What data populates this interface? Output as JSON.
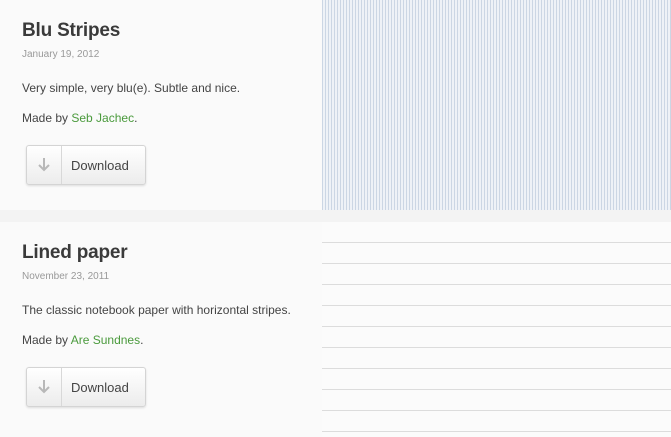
{
  "patterns": [
    {
      "title": "Blu Stripes",
      "date": "January 19, 2012",
      "description": "Very simple, very blu(e). Subtle and nice.",
      "made_by_prefix": "Made by ",
      "author": "Seb Jachec",
      "made_by_suffix": ".",
      "download_label": "Download",
      "preview": "blue vertical stripes"
    },
    {
      "title": "Lined paper",
      "date": "November 23, 2011",
      "description": "The classic notebook paper with horizontal stripes.",
      "made_by_prefix": "Made by ",
      "author": "Are Sundnes",
      "made_by_suffix": ".",
      "download_label": "Download",
      "preview": "horizontal ruled lines"
    }
  ],
  "colors": {
    "link": "#4a9a3c",
    "card_bg": "#fafafa"
  },
  "icons": {
    "download": "down-arrow-icon"
  }
}
